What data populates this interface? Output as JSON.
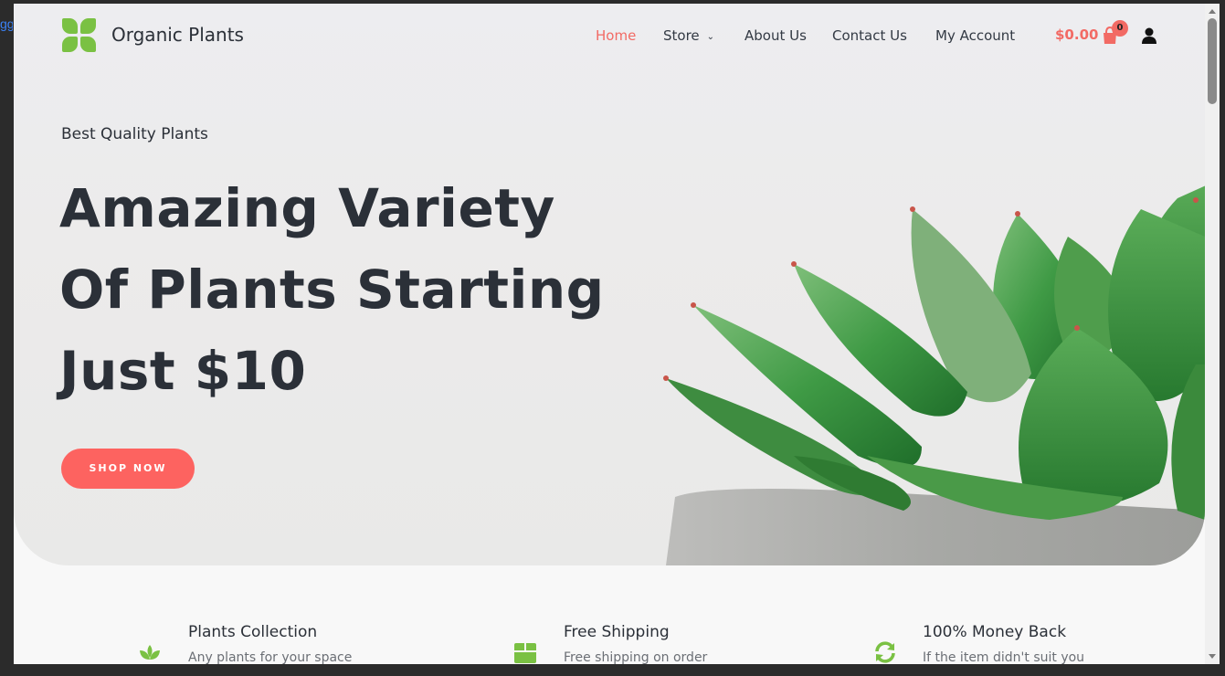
{
  "browser": {
    "side_link_text": "gg"
  },
  "header": {
    "site_title": "Organic Plants",
    "nav": [
      {
        "label": "Home",
        "active": true
      },
      {
        "label": "Store",
        "has_dropdown": true
      },
      {
        "label": "About Us"
      },
      {
        "label": "Contact Us"
      },
      {
        "label": "My Account"
      }
    ],
    "cart": {
      "total": "$0.00",
      "count": "0"
    }
  },
  "hero": {
    "eyebrow": "Best Quality Plants",
    "headline_lines": [
      "Amazing Variety",
      "Of Plants Starting",
      "Just $10"
    ],
    "cta_label": "SHOP NOW"
  },
  "features": [
    {
      "icon": "sprout-icon",
      "title": "Plants Collection",
      "desc": "Any plants for your space"
    },
    {
      "icon": "box-icon",
      "title": "Free Shipping",
      "desc": "Free shipping on order"
    },
    {
      "icon": "refresh-icon",
      "title": "100% Money Back",
      "desc": "If the item didn't suit you"
    }
  ],
  "colors": {
    "accent": "#fd6360",
    "brand_green": "#7ac143",
    "text": "#2b3038"
  }
}
